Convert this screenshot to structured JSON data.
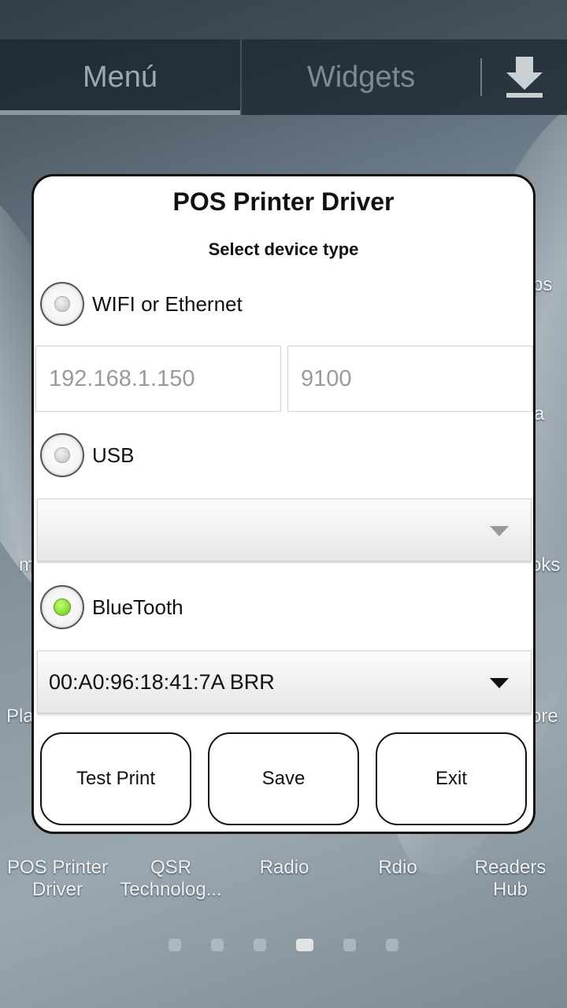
{
  "launcher": {
    "tabs": {
      "menu": "Menú",
      "widgets": "Widgets"
    },
    "bottom_apps": [
      {
        "label": "POS Printer Driver"
      },
      {
        "label": "QSR Technolog..."
      },
      {
        "label": "Radio"
      },
      {
        "label": "Rdio"
      },
      {
        "label": "Readers Hub"
      }
    ],
    "partial_labels": {
      "m": "m",
      "pla": "Pla",
      "ps": "ps",
      "a": "a",
      "oks": "oks",
      "ore": "ore"
    },
    "page_indicator": {
      "count": 6,
      "active_index": 3
    }
  },
  "dialog": {
    "title": "POS Printer Driver",
    "subtitle": "Select device type",
    "options": {
      "wifi": {
        "label": "WIFI or Ethernet",
        "checked": false
      },
      "usb": {
        "label": "USB",
        "checked": false
      },
      "bluetooth": {
        "label": "BlueTooth",
        "checked": true
      }
    },
    "ip_placeholder": "192.168.1.150",
    "port_placeholder": "9100",
    "usb_select_value": "",
    "bluetooth_select_value": "00:A0:96:18:41:7A BRR",
    "buttons": {
      "test_print": "Test Print",
      "save": "Save",
      "exit": "Exit"
    }
  },
  "colors": {
    "radio_checked": "#62c416",
    "dialog_border": "#111111"
  }
}
